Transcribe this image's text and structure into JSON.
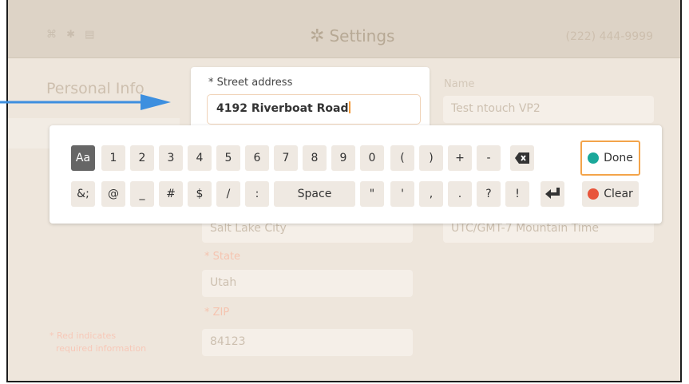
{
  "header": {
    "status_icons": "⌘ ✱ ▤",
    "title": "Settings",
    "phone": "(222) 444-9999"
  },
  "left_panel": {
    "section_title": "Personal Info",
    "note_line1": "* Red indicates",
    "note_line2": "required information"
  },
  "form": {
    "name_label": "Name",
    "name_value": "Test ntouch VP2",
    "city_value": "Salt Lake City",
    "timezone_value": "UTC/GMT-7 Mountain Time",
    "state_label": "* State",
    "state_value": "Utah",
    "zip_label": "* ZIP",
    "zip_value": "84123"
  },
  "popup": {
    "label": "* Street address",
    "value": "4192 Riverboat Road"
  },
  "keyboard": {
    "row1": [
      "Aa",
      "1",
      "2",
      "3",
      "4",
      "5",
      "6",
      "7",
      "8",
      "9",
      "0",
      "(",
      ")",
      "+",
      "-"
    ],
    "row2": [
      "&;",
      "@",
      "_",
      "#",
      "$",
      "/",
      ":",
      "Space",
      "\"",
      "'",
      ",",
      ".",
      "?",
      "!"
    ],
    "done_label": "Done",
    "clear_label": "Clear",
    "colors": {
      "done_dot": "#1aa89a",
      "clear_dot": "#e8553b",
      "highlight": "#f3a44a"
    }
  },
  "icons": {
    "backspace": "backspace-icon",
    "enter": "enter-icon",
    "gear": "gear-icon"
  }
}
